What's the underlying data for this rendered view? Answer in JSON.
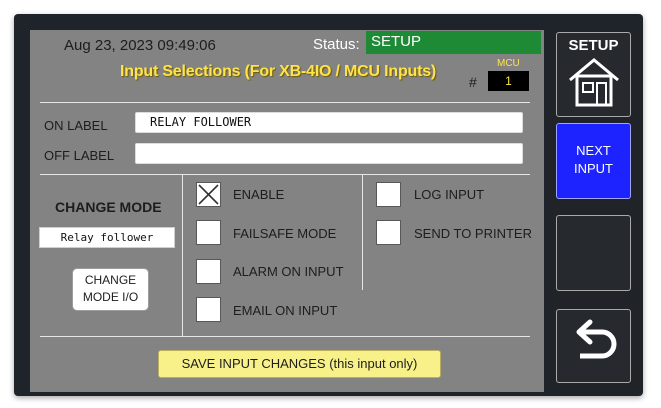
{
  "header": {
    "datetime": "Aug 23, 2023 09:49:06",
    "status_label": "Status:",
    "status_value": "SETUP",
    "title": "Input Selections (For XB-4IO / MCU Inputs)",
    "hash": "#",
    "mcu_label": "MCU",
    "mcu_value": "1"
  },
  "labels": {
    "on_label": "ON LABEL",
    "on_value": "RELAY FOLLOWER",
    "off_label": "OFF LABEL",
    "off_value": ""
  },
  "mode": {
    "title": "CHANGE MODE",
    "value": "Relay follower",
    "button_line1": "CHANGE",
    "button_line2": "MODE I/O"
  },
  "options": {
    "enable": "ENABLE",
    "failsafe": "FAILSAFE MODE",
    "alarm": "ALARM ON INPUT",
    "email": "EMAIL ON INPUT",
    "log": "LOG INPUT",
    "printer": "SEND TO PRINTER"
  },
  "checked": {
    "enable": true,
    "failsafe": false,
    "alarm": false,
    "email": false,
    "log": false,
    "printer": false
  },
  "save_button": "SAVE INPUT CHANGES (this input only)",
  "sidebar": {
    "setup_label": "SETUP",
    "next_line1": "NEXT",
    "next_line2": "INPUT"
  },
  "colors": {
    "status_green": "#1e8a35",
    "title_yellow": "#ffe34a",
    "next_blue": "#1c23ff",
    "save_yellow": "#f8f18a"
  },
  "icons": [
    "home-icon",
    "checkmark-x-icon",
    "back-arrow-icon"
  ]
}
